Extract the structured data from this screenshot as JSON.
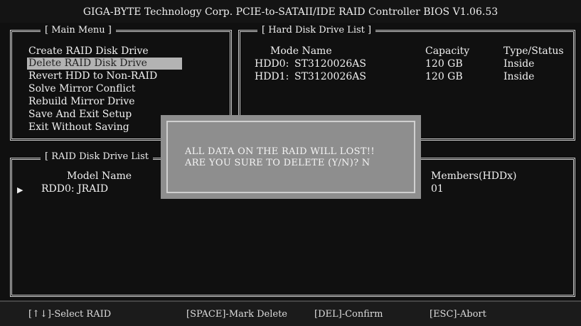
{
  "title": "GIGA-BYTE Technology Corp. PCIE-to-SATAII/IDE RAID Controller BIOS V1.06.53",
  "main_menu": {
    "title": "[ Main Menu ]",
    "items": [
      {
        "label": "Create RAID Disk Drive",
        "selected": false
      },
      {
        "label": "Delete RAID Disk Drive",
        "selected": true
      },
      {
        "label": "Revert HDD to Non-RAID",
        "selected": false
      },
      {
        "label": "Solve Mirror Conflict",
        "selected": false
      },
      {
        "label": "Rebuild Mirror Drive",
        "selected": false
      },
      {
        "label": "Save And Exit Setup",
        "selected": false
      },
      {
        "label": "Exit Without Saving",
        "selected": false
      }
    ]
  },
  "hdd_list": {
    "title": "[ Hard Disk Drive List ]",
    "headers": {
      "mode_name": "Mode Name",
      "capacity": "Capacity",
      "type_status": "Type/Status"
    },
    "rows": [
      {
        "id": "HDD0:",
        "model": "ST3120026AS",
        "capacity": "120 GB",
        "type_status": "Inside"
      },
      {
        "id": "HDD1:",
        "model": "ST3120026AS",
        "capacity": "120 GB",
        "type_status": "Inside"
      }
    ]
  },
  "raid_list": {
    "title": "[ RAID Disk Drive List",
    "headers": {
      "model_name": "Model Name",
      "members": "Members(HDDx)"
    },
    "rows": [
      {
        "name": "RDD0: JRAID",
        "members": "01"
      }
    ]
  },
  "dialog": {
    "line1": "ALL DATA ON THE RAID WILL LOST!!",
    "line2": "ARE YOU SURE TO DELETE (Y/N)? N"
  },
  "footer": {
    "select": "[↑↓]-Select RAID",
    "mark": "[SPACE]-Mark Delete",
    "confirm": "[DEL]-Confirm",
    "abort": "[ESC]-Abort"
  }
}
